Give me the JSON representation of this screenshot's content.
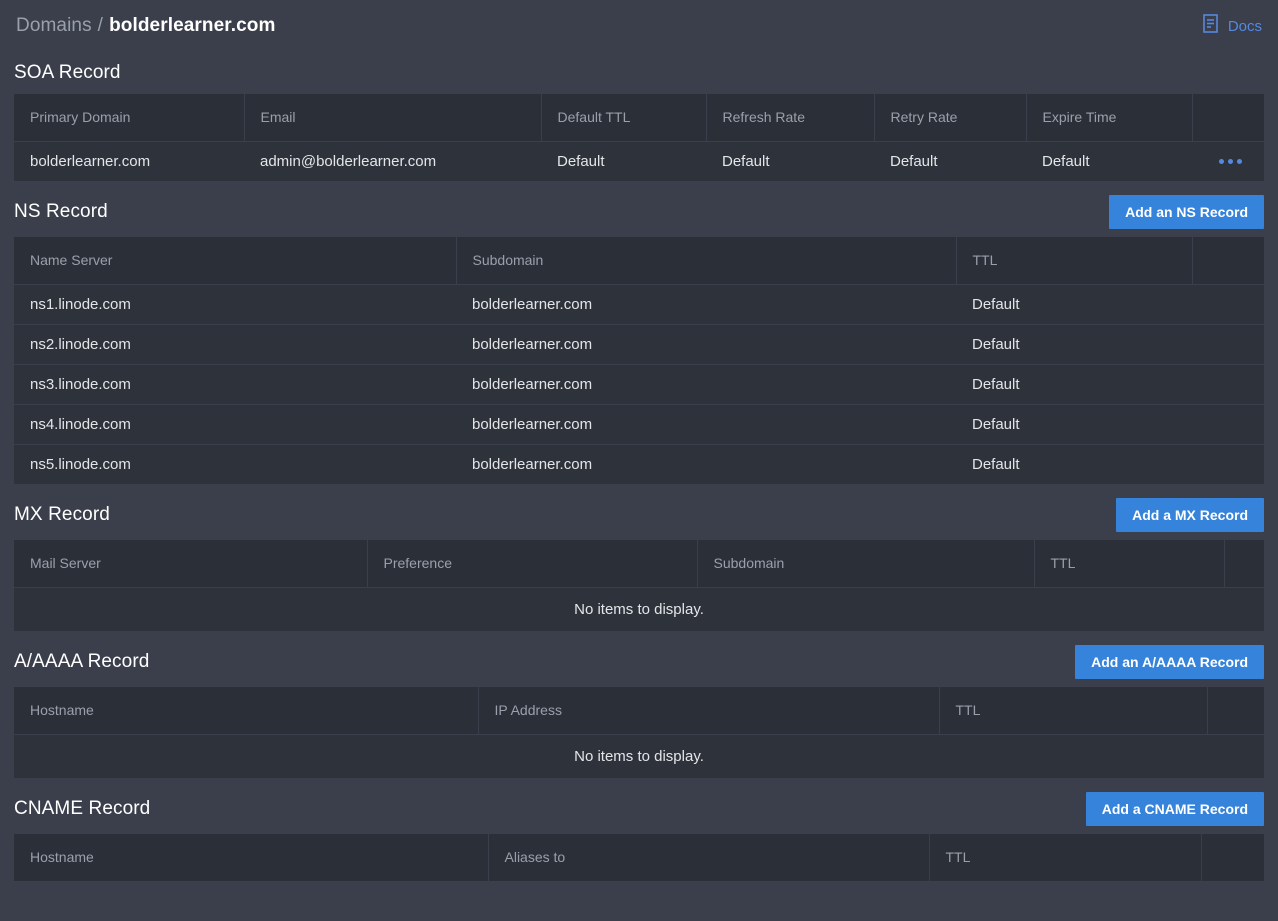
{
  "header": {
    "breadcrumb_root": "Domains",
    "breadcrumb_sep": "/",
    "breadcrumb_current": "bolderlearner.com",
    "docs_label": "Docs",
    "docs_icon": "document-icon"
  },
  "colors": {
    "page_background": "#3a3f4b",
    "table_background": "#2e323b",
    "table_header_background": "#2b2f38",
    "accent_blue": "#3683dc",
    "link_blue": "#5588e0",
    "muted_text": "#9aa0ab",
    "primary_text": "#e3e5e8"
  },
  "sections": {
    "soa": {
      "title": "SOA Record",
      "columns": [
        "Primary Domain",
        "Email",
        "Default TTL",
        "Refresh Rate",
        "Retry Rate",
        "Expire Time",
        ""
      ],
      "rows": [
        {
          "primary_domain": "bolderlearner.com",
          "email": "admin@bolderlearner.com",
          "default_ttl": "Default",
          "refresh_rate": "Default",
          "retry_rate": "Default",
          "expire_time": "Default",
          "actions_icon": "kebab-menu-icon"
        }
      ]
    },
    "ns": {
      "title": "NS Record",
      "add_button": "Add an NS Record",
      "columns": [
        "Name Server",
        "Subdomain",
        "TTL",
        ""
      ],
      "rows": [
        {
          "name_server": "ns1.linode.com",
          "subdomain": "bolderlearner.com",
          "ttl": "Default"
        },
        {
          "name_server": "ns2.linode.com",
          "subdomain": "bolderlearner.com",
          "ttl": "Default"
        },
        {
          "name_server": "ns3.linode.com",
          "subdomain": "bolderlearner.com",
          "ttl": "Default"
        },
        {
          "name_server": "ns4.linode.com",
          "subdomain": "bolderlearner.com",
          "ttl": "Default"
        },
        {
          "name_server": "ns5.linode.com",
          "subdomain": "bolderlearner.com",
          "ttl": "Default"
        }
      ]
    },
    "mx": {
      "title": "MX Record",
      "add_button": "Add a MX Record",
      "columns": [
        "Mail Server",
        "Preference",
        "Subdomain",
        "TTL",
        ""
      ],
      "empty_message": "No items to display."
    },
    "aaaa": {
      "title": "A/AAAA Record",
      "add_button": "Add an A/AAAA Record",
      "columns": [
        "Hostname",
        "IP Address",
        "TTL",
        ""
      ],
      "empty_message": "No items to display."
    },
    "cname": {
      "title": "CNAME Record",
      "add_button": "Add a CNAME Record",
      "columns": [
        "Hostname",
        "Aliases to",
        "TTL",
        ""
      ]
    }
  }
}
